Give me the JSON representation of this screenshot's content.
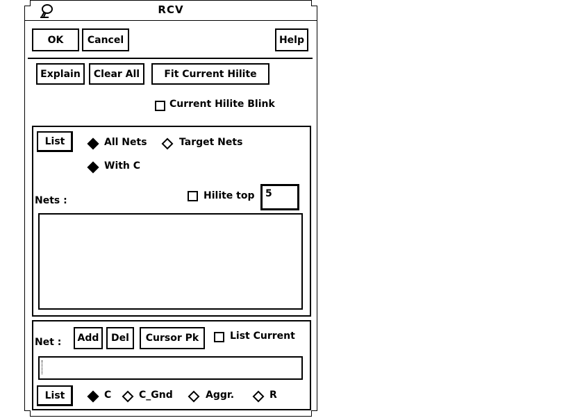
{
  "window": {
    "title": "RCV",
    "menu_icon": "window-menu-icon"
  },
  "top_buttons": {
    "ok": "OK",
    "cancel": "Cancel",
    "help": "Help"
  },
  "actions": {
    "explain": "Explain",
    "clear_all": "Clear All",
    "fit_current_hilite": "Fit Current Hilite"
  },
  "current_hilite_blink": {
    "label": "Current Hilite Blink",
    "checked": false
  },
  "list_panel": {
    "list_button": "List",
    "scope_options": [
      {
        "label": "All Nets",
        "selected": true
      },
      {
        "label": "Target Nets",
        "selected": false
      }
    ],
    "with_c": {
      "label": "With C",
      "selected": true
    },
    "nets_label": "Nets :",
    "hilite_top": {
      "label": "Hilite top",
      "checked": false,
      "value": "5"
    },
    "nets_list": []
  },
  "net_panel": {
    "net_label": "Net :",
    "add": "Add",
    "del": "Del",
    "cursor_pk": "Cursor Pk",
    "list_current": {
      "label": "List Current",
      "checked": false
    },
    "net_input_value": "",
    "list_button": "List",
    "type_options": [
      {
        "label": "C",
        "selected": true
      },
      {
        "label": "C_Gnd",
        "selected": false
      },
      {
        "label": "Aggr.",
        "selected": false
      },
      {
        "label": "R",
        "selected": false
      }
    ]
  }
}
